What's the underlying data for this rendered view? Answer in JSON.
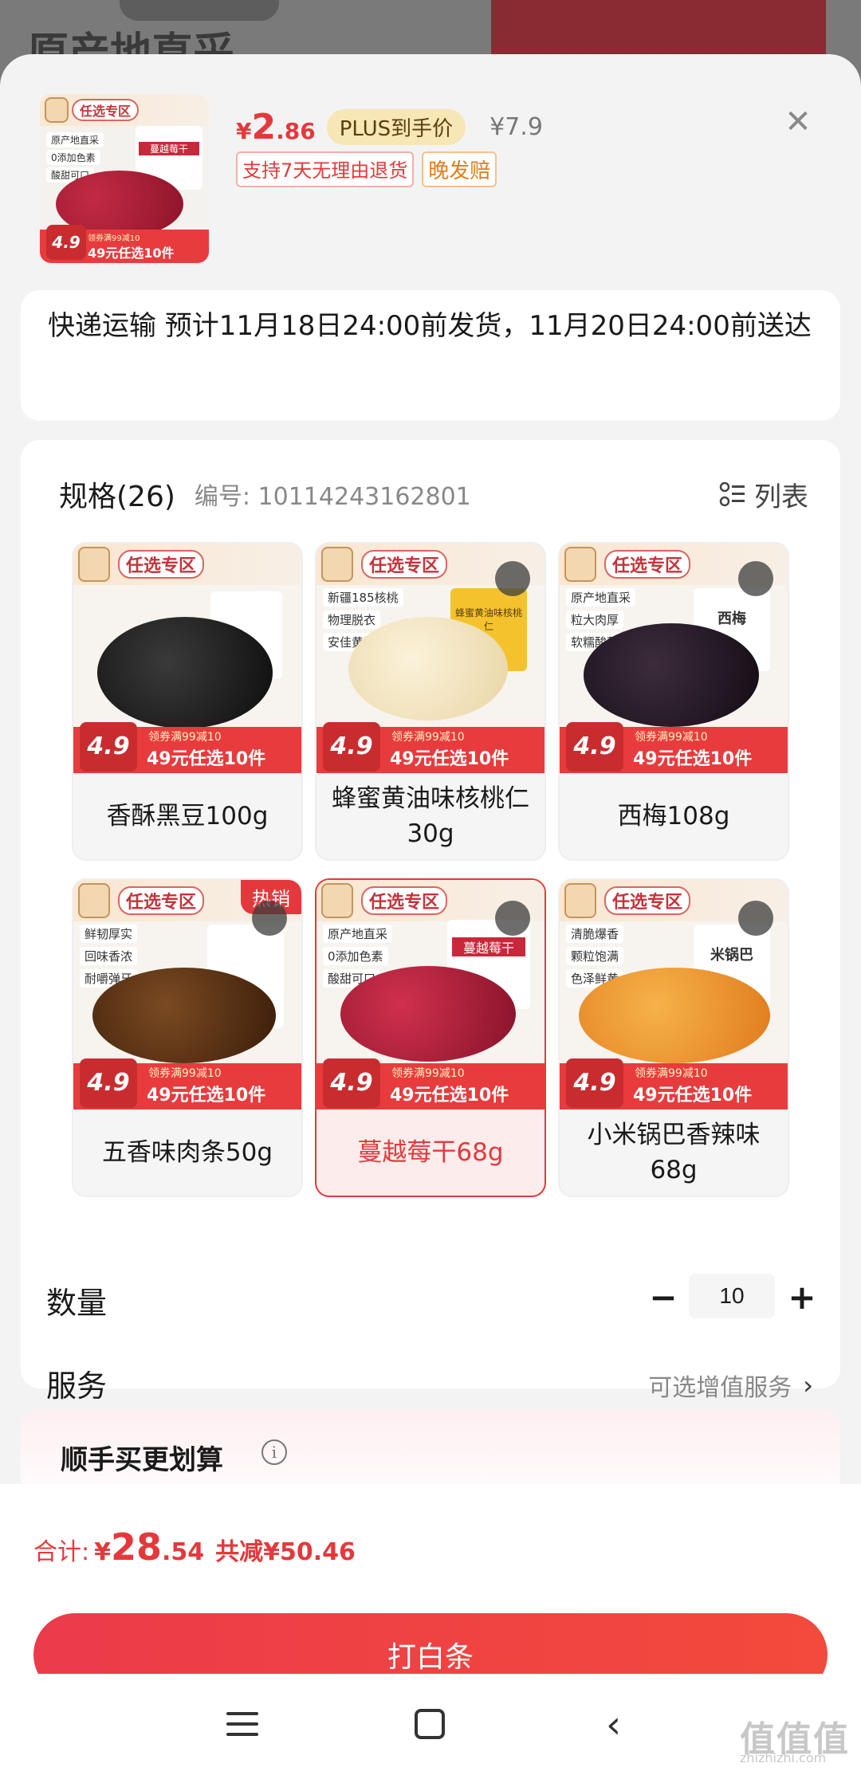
{
  "background": {
    "title": "原产地直采"
  },
  "product": {
    "price_symbol": "¥",
    "price_int": "2",
    "price_dec": ".86",
    "plus_badge": "PLUS到手价",
    "original_price": "¥7.9",
    "tags": [
      "支持7天无理由退货",
      "晚发赔"
    ],
    "close_icon": "close-icon"
  },
  "thumb": {
    "zone": "任选专区",
    "features": [
      "原产地直采",
      "0添加色素",
      "酸甜可口"
    ],
    "pack_label": "蔓越莓干",
    "promo_big": "4.9",
    "promo_coupon": "领券满99减10",
    "promo_slogan": "49元任选10件"
  },
  "delivery": {
    "text": "快递运输 预计11月18日24:00前发货，11月20日24:00前送达"
  },
  "spec": {
    "title": "规格(26)",
    "code": "编号: 10114243162801",
    "list_toggle": "列表",
    "items": [
      {
        "label": "香酥黑豆100g",
        "features": [
          "",
          "",
          ""
        ],
        "pack": ""
      },
      {
        "label": "蜂蜜黄油味核桃仁30g",
        "features": [
          "新疆185核桃",
          "物理脱衣",
          "安佳黄油"
        ],
        "pack": "蜂蜜黄油味核桃仁"
      },
      {
        "label": "西梅108g",
        "features": [
          "原产地直采",
          "粒大肉厚",
          "软糯酸甜"
        ],
        "pack": "西梅"
      },
      {
        "label": "五香味肉条50g",
        "features": [
          "鲜韧厚实",
          "回味香浓",
          "耐嚼弹牙"
        ],
        "pack": "",
        "hot": "热销"
      },
      {
        "label": "蔓越莓干68g",
        "features": [
          "原产地直采",
          "0添加色素",
          "酸甜可口"
        ],
        "pack": "蔓越莓干",
        "selected": true
      },
      {
        "label": "小米锅巴香辣味68g",
        "features": [
          "清脆爆香",
          "颗粒饱满",
          "色泽鲜黄"
        ],
        "pack": "米锅巴"
      }
    ],
    "promo_big": "4.9",
    "promo_coupon": "领券满99减10",
    "promo_slogan": "49元任选10件",
    "zone": "任选专区"
  },
  "quantity": {
    "label": "数量",
    "value": "10",
    "minus": "−",
    "plus": "+"
  },
  "service": {
    "label": "服务",
    "hint": "可选增值服务",
    "chevron": "›"
  },
  "bundle": {
    "title": "顺手买更划算",
    "info": "i"
  },
  "total": {
    "label": "合计:",
    "yen": "¥",
    "int": "28",
    "dec": ".54",
    "save": "共减¥50.46"
  },
  "pay_button": "打白条",
  "watermark": {
    "main": "值值值",
    "sub": "zhizhizhi.com"
  },
  "colors": {
    "accent": "#e4393c",
    "plus_badge_bg": "#f7e7b6",
    "sheet_bg": "#f3f3f3"
  }
}
